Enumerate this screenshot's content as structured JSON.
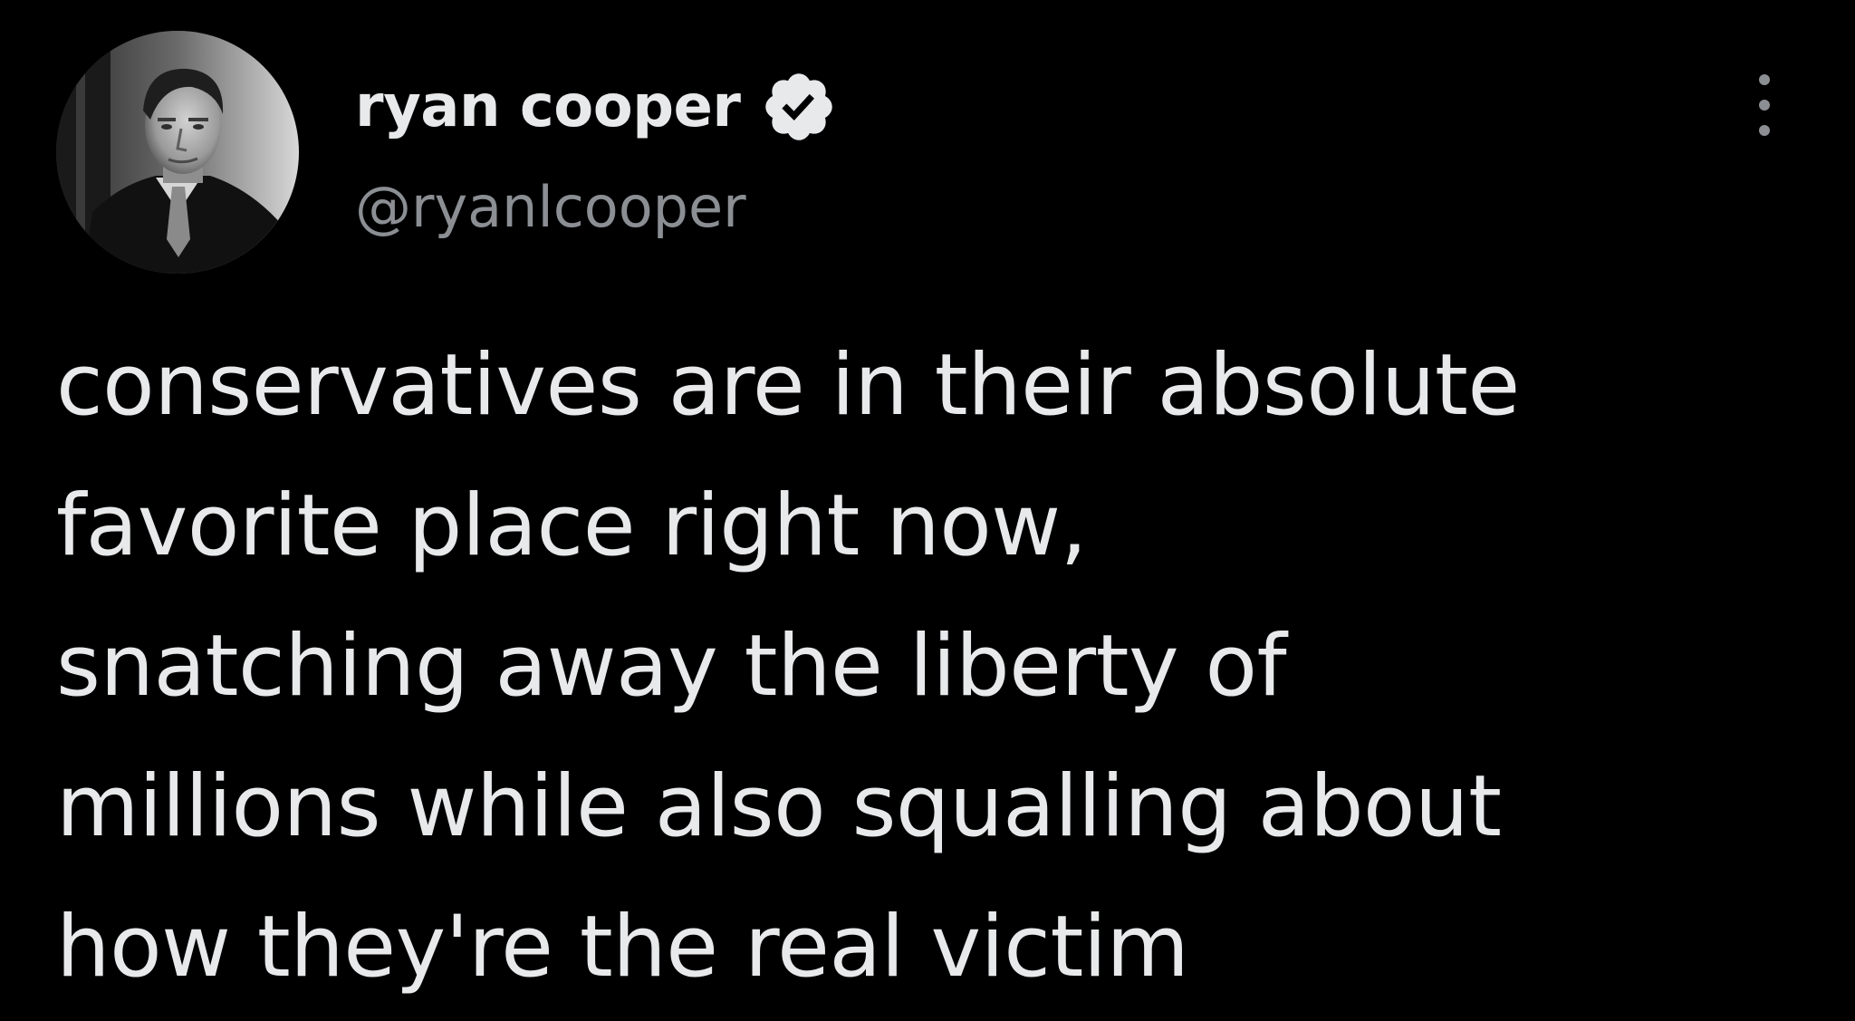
{
  "tweet": {
    "author": {
      "display_name": "ryan cooper",
      "handle": "@ryanlcooper",
      "verified": true,
      "avatar_icon": "profile-photo"
    },
    "more_icon": "more-options-icon",
    "text_lines": [
      "conservatives are in their absolute",
      "favorite place right now,",
      "snatching away the liberty of",
      "millions while also squalling about",
      "how they're the real victim"
    ]
  },
  "colors": {
    "background": "#000000",
    "primary_text": "#e7e9ea",
    "secondary_text": "#8b8f94",
    "badge_fill": "#e7e9ea",
    "badge_check": "#000000"
  }
}
